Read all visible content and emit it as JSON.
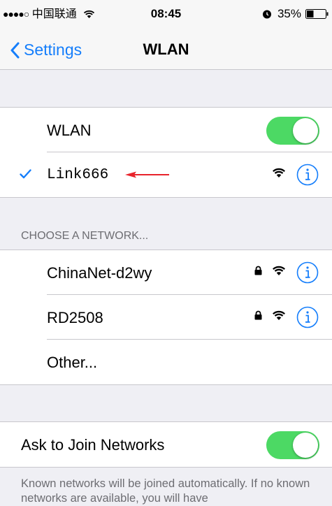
{
  "status_bar": {
    "signal_dots": "●●●●○",
    "carrier": "中国联通",
    "time": "08:45",
    "battery_percent": "35%",
    "icons": [
      "wifi-icon",
      "alarm-icon",
      "battery-icon"
    ]
  },
  "nav": {
    "back_label": "Settings",
    "title": "WLAN"
  },
  "wlan_toggle": {
    "label": "WLAN",
    "on": true
  },
  "connected_network": {
    "name": "Link666",
    "checked": true,
    "icons": [
      "checkmark-icon",
      "red-arrow-icon",
      "wifi-icon",
      "info-icon"
    ]
  },
  "choose_header": "CHOOSE A NETWORK...",
  "networks": [
    {
      "name": "ChinaNet-d2wy",
      "locked": true
    },
    {
      "name": "RD2508",
      "locked": true
    }
  ],
  "other_label": "Other...",
  "ask_to_join": {
    "label": "Ask to Join Networks",
    "on": true
  },
  "footer": "Known networks will be joined automatically. If no known networks are available, you will have",
  "colors": {
    "accent": "#157efb",
    "toggle_on": "#4cd964",
    "arrow": "#e8232b",
    "background": "#efeff4"
  }
}
